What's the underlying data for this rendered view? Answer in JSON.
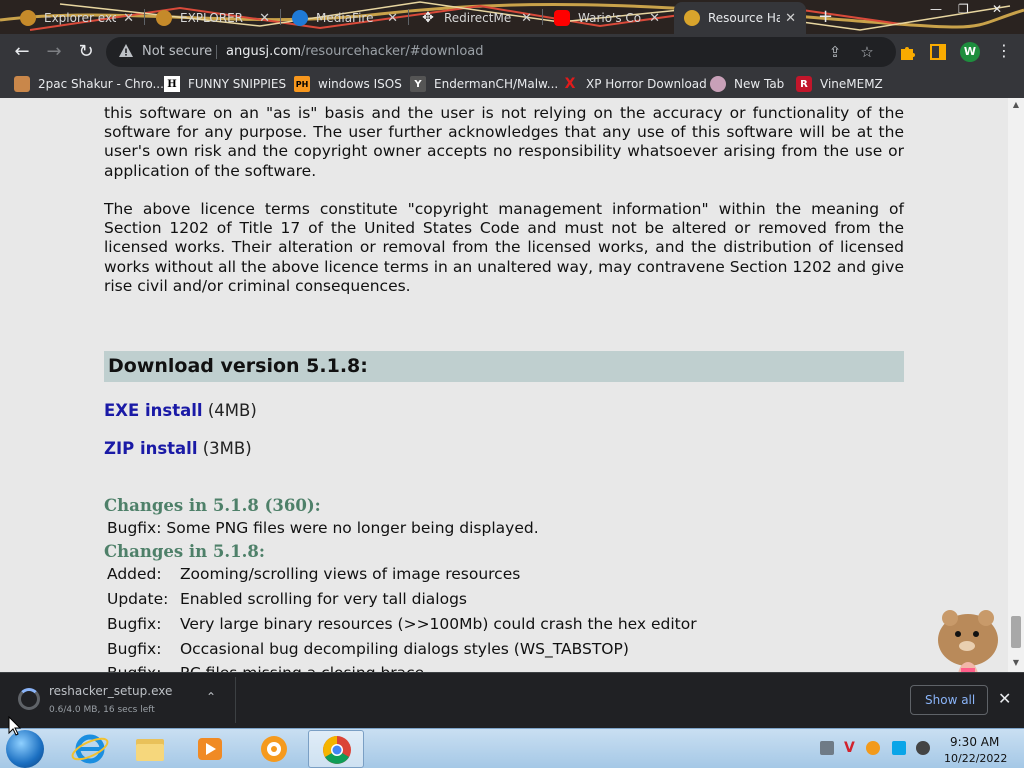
{
  "browser": {
    "tabs": [
      {
        "label": "Explorer exe",
        "favicon": "globe-icon",
        "close": "✕"
      },
      {
        "label": "EXPLORER",
        "favicon": "globe-icon",
        "close": "✕"
      },
      {
        "label": "MediaFire",
        "favicon": "mediafire-icon",
        "close": "✕"
      },
      {
        "label": "RedirectMe",
        "favicon": "move-icon",
        "close": "✕"
      },
      {
        "label": "Wario's Co",
        "favicon": "youtube-icon",
        "close": "✕"
      },
      {
        "label": "Resource Ha",
        "favicon": "resource-hacker-icon",
        "close": "✕"
      }
    ],
    "new_tab": "+",
    "window_controls": [
      "—",
      "❐",
      "✕"
    ],
    "omnibox": {
      "security_label": "Not secure",
      "url_host": "angusj.com",
      "url_path": "/resourcehacker/#download"
    },
    "profile_initial": "W",
    "bookmarks": [
      {
        "label": "2pac Shakur - Chro...",
        "icon": "bookmark-icon",
        "glyph": ""
      },
      {
        "label": "FUNNY SNIPPIES",
        "icon": "letter-h-icon",
        "glyph": "H"
      },
      {
        "label": "windows ISOS",
        "icon": "ph-icon",
        "glyph": "PH"
      },
      {
        "label": "EndermanCH/Malw...",
        "icon": "ya-icon",
        "glyph": "Y"
      },
      {
        "label": "XP Horror Download",
        "icon": "x-icon",
        "glyph": "X"
      },
      {
        "label": "New Tab",
        "icon": "newtab-icon",
        "glyph": ""
      },
      {
        "label": "VineMEMZ",
        "icon": "r-icon",
        "glyph": "R"
      }
    ]
  },
  "page": {
    "para1": "this software on an \"as is\" basis and the user is not relying on the accuracy or functionality of the software for any purpose. The user further acknowledges that any use of this software will be at the user's own risk and the copyright owner accepts no responsibility whatsoever arising from the use or application of the software.",
    "para2": "The above licence terms constitute \"copyright management information\" within the meaning of Section 1202 of Title 17 of the United States Code and must not be altered or removed from the licensed works. Their alteration or removal from the licensed works, and the distribution of licensed works without all the above licence terms in an unaltered way, may contravene Section 1202 and give rise civil and/or criminal consequences.",
    "download_heading": "Download version 5.1.8:",
    "exe_link": "EXE install",
    "exe_size": "(4MB)",
    "zip_link": "ZIP install",
    "zip_size": "(3MB)",
    "changes_heading_1": "Changes in 5.1.8 (360):",
    "changes_1": [
      {
        "kind": "Bugfix:",
        "text": "Some PNG files were no longer being displayed."
      }
    ],
    "changes_heading_2": "Changes in 5.1.8:",
    "changes_2": [
      {
        "kind": "Added:",
        "text": "Zooming/scrolling views of image resources"
      },
      {
        "kind": "Update:",
        "text": "Enabled scrolling for very tall dialogs"
      },
      {
        "kind": "Bugfix:",
        "text": "Very large binary resources (>>100Mb) could crash the hex editor"
      },
      {
        "kind": "Bugfix:",
        "text": "Occasional bug decompiling dialogs styles (WS_TABSTOP)"
      },
      {
        "kind": "Bugfix:",
        "text": "RC files missing a closing brace, ..."
      }
    ]
  },
  "download_shelf": {
    "filename": "reshacker_setup.exe",
    "status": "0.6/4.0 MB, 16 secs left",
    "show_all": "Show all",
    "close": "✕"
  },
  "taskbar": {
    "apps": [
      "start-orb-icon",
      "internet-explorer-icon",
      "file-explorer-icon",
      "media-player-icon",
      "shuriken-app-icon",
      "chrome-icon"
    ],
    "clock_time": "9:30 AM",
    "clock_date": "10/22/2022"
  },
  "colors": {
    "link": "#1a1aa6",
    "changes_heading": "#4e8069",
    "download_heading_bg": "#bfcfcf",
    "page_bg": "#e8e8e8",
    "chrome_dark": "#35363a"
  }
}
